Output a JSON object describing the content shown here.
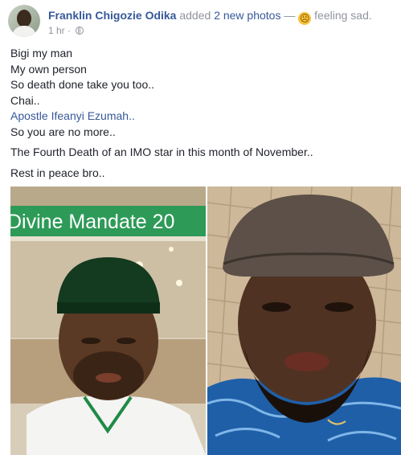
{
  "post": {
    "author": "Franklin Chigozie Odika",
    "action": "added",
    "photos_link": "2 new photos",
    "separator": "—",
    "feeling_icon": "sad-face-emoji",
    "feeling": "feeling sad.",
    "time": "1 hr",
    "dot": "·",
    "privacy_icon": "globe-icon"
  },
  "body": {
    "lines": [
      "Bigi my man",
      "My own person",
      "So death done take you too..",
      "Chai..",
      "Apostle Ifeanyi Ezumah..",
      "So you are no more..",
      "The Fourth Death of an IMO star in this month of November..",
      "Rest in peace bro.."
    ]
  },
  "photos": {
    "left_banner": "Divine Mandate 20"
  }
}
